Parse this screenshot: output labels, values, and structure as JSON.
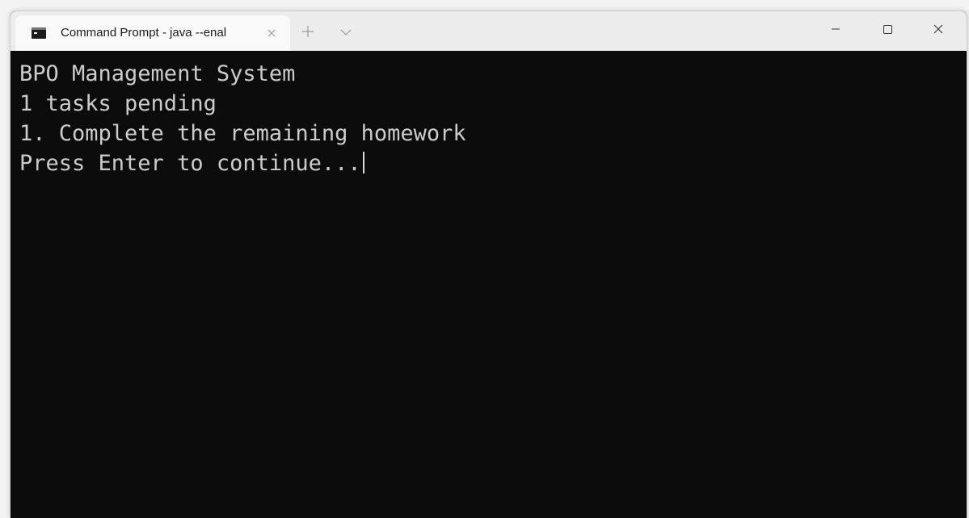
{
  "window": {
    "tab_title": "Command Prompt - java  --enal",
    "tab_icon": "terminal-icon",
    "new_tab_icon": "plus-icon",
    "dropdown_icon": "chevron-down-icon",
    "controls": [
      "minimize-icon",
      "maximize-icon",
      "close-icon"
    ]
  },
  "terminal": {
    "lines": [
      "BPO Management System",
      "1 tasks pending",
      "1. Complete the remaining homework",
      "Press Enter to continue..."
    ],
    "colors": {
      "background": "#0c0c0c",
      "foreground": "#cccccc",
      "titlebar": "#ececec",
      "tab": "#f9f9f9"
    }
  }
}
